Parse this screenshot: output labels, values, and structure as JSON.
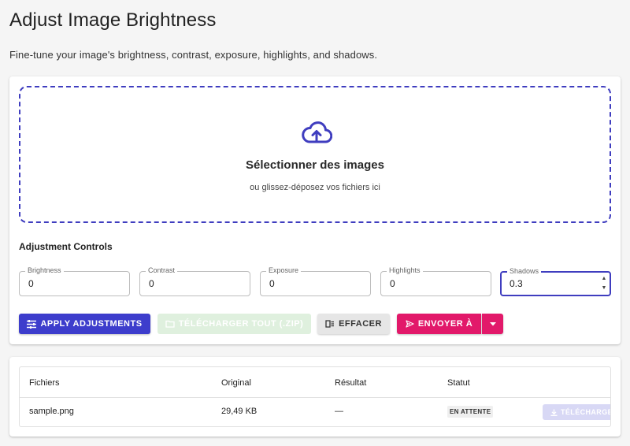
{
  "header": {
    "title": "Adjust Image Brightness",
    "subtitle": "Fine-tune your image's brightness, contrast, exposure, highlights, and shadows."
  },
  "dropzone": {
    "title": "Sélectionner des images",
    "subtitle": "ou glissez-déposez vos fichiers ici",
    "icon": "cloud-upload-icon"
  },
  "controls": {
    "title": "Adjustment Controls",
    "fields": [
      {
        "label": "Brightness",
        "value": "0"
      },
      {
        "label": "Contrast",
        "value": "0"
      },
      {
        "label": "Exposure",
        "value": "0"
      },
      {
        "label": "Highlights",
        "value": "0"
      },
      {
        "label": "Shadows",
        "value": "0.3"
      }
    ]
  },
  "actions": {
    "apply": "APPLY ADJUSTMENTS",
    "download_all": "TÉLÉCHARGER TOUT (.ZIP)",
    "clear": "EFFACER",
    "send_to": "ENVOYER À"
  },
  "table": {
    "headers": [
      "Fichiers",
      "Original",
      "Résultat",
      "Statut"
    ],
    "rows": [
      {
        "file": "sample.png",
        "original": "29,49 KB",
        "result": "—",
        "status": "EN ATTENTE",
        "action": "TÉLÉCHARGER"
      }
    ]
  },
  "colors": {
    "accent": "#3d3dcc",
    "send": "#e2196a",
    "download_disabled": "#dff0de"
  }
}
